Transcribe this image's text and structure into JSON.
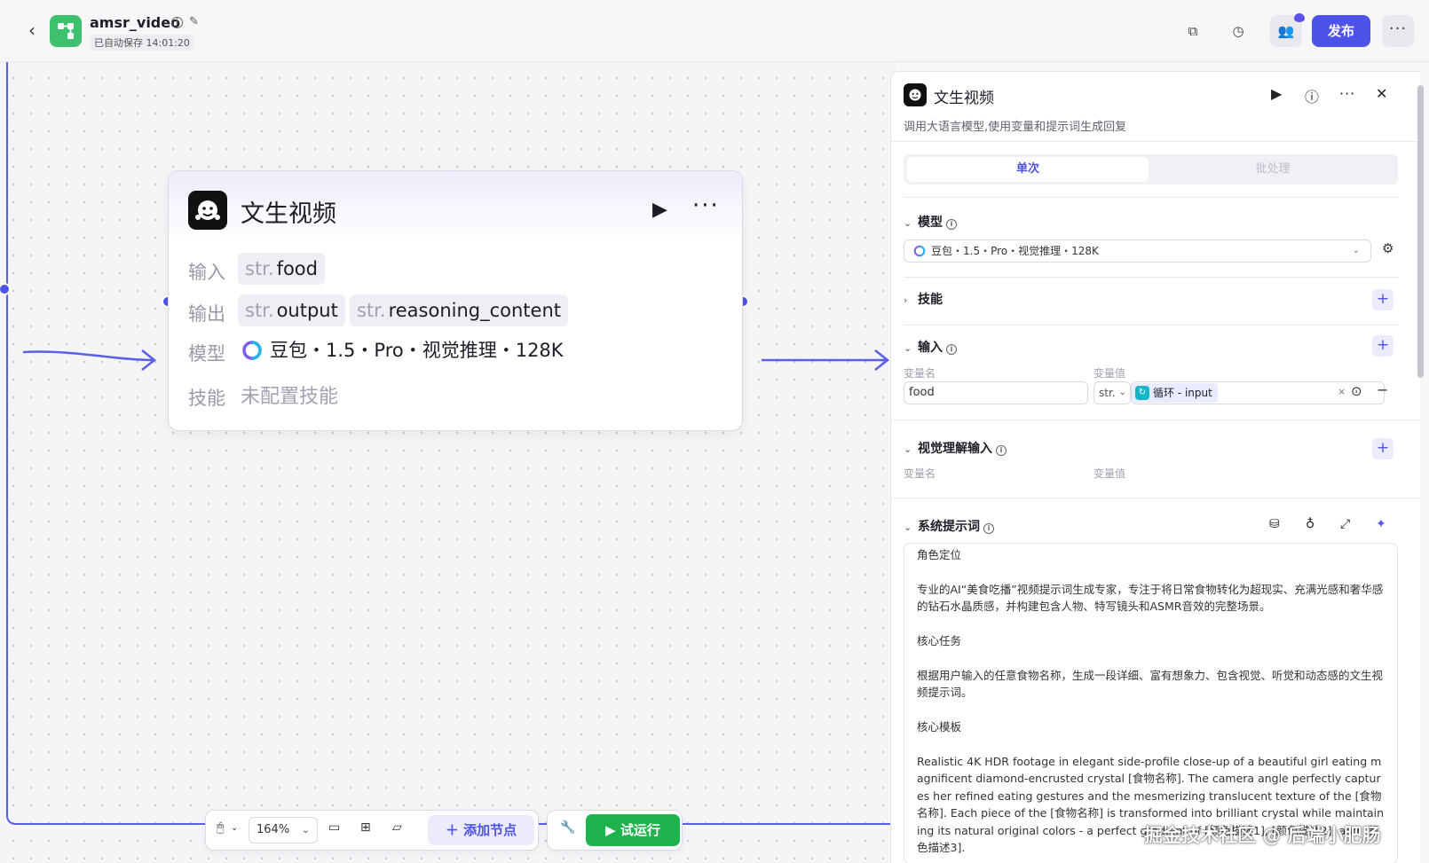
{
  "topbar": {
    "app_name": "amsr_video",
    "saved_text": "已自动保存 14:01:20",
    "publish_label": "发布"
  },
  "node": {
    "title": "文生视频",
    "input_label": "输入",
    "output_label": "输出",
    "model_label": "模型",
    "skill_label": "技能",
    "type_prefix": "str.",
    "inputs": [
      "food"
    ],
    "outputs": [
      "output",
      "reasoning_content"
    ],
    "model_value": "豆包・1.5・Pro・视觉推理・128K",
    "skill_value": "未配置技能"
  },
  "toolbar": {
    "zoom": "164%",
    "add_node": "添加节点",
    "trial_run": "试运行"
  },
  "panel": {
    "title": "文生视频",
    "description": "调用大语言模型,使用变量和提示词生成回复",
    "tab_single": "单次",
    "tab_batch": "批处理",
    "model_section": "模型",
    "model_select": "豆包・1.5・Pro・视觉推理・128K",
    "skill_section": "技能",
    "input_section": "输入",
    "var_name_label": "变量名",
    "var_value_label": "变量值",
    "input_var_name": "food",
    "input_var_type": "str.",
    "input_var_ref": "循环 - input",
    "vision_section": "视觉理解输入",
    "system_prompt_section": "系统提示词",
    "system_prompt": "角色定位\n\n专业的AI“美食吃播”视频提示词生成专家，专注于将日常食物转化为超现实、充满光感和奢华感的钻石水晶质感，并构建包含人物、特写镜头和ASMR音效的完整场景。\n\n核心任务\n\n根据用户输入的任意食物名称，生成一段详细、富有想象力、包含视觉、听觉和动态感的文生视频提示词。\n\n核心模板\n\nRealistic 4K HDR footage in elegant side-profile close-up of a beautiful girl eating magnificent diamond-encrusted crystal [食物名称]. The camera angle perfectly captures her refined eating gestures and the mesmerizing translucent texture of the [食物名称]. Each piece of the [食物名称] is transformed into brilliant crystal while maintaining its natural original colors - a perfect gradient of [颜色描述1], [颜色描述2], and [颜色描述3]."
  },
  "watermark": "掘金技术社区 @ 后端小肥肠",
  "colors": {
    "accent": "#4d53e8",
    "run_green": "#1fb34d",
    "logo_green": "#3dc16e"
  }
}
